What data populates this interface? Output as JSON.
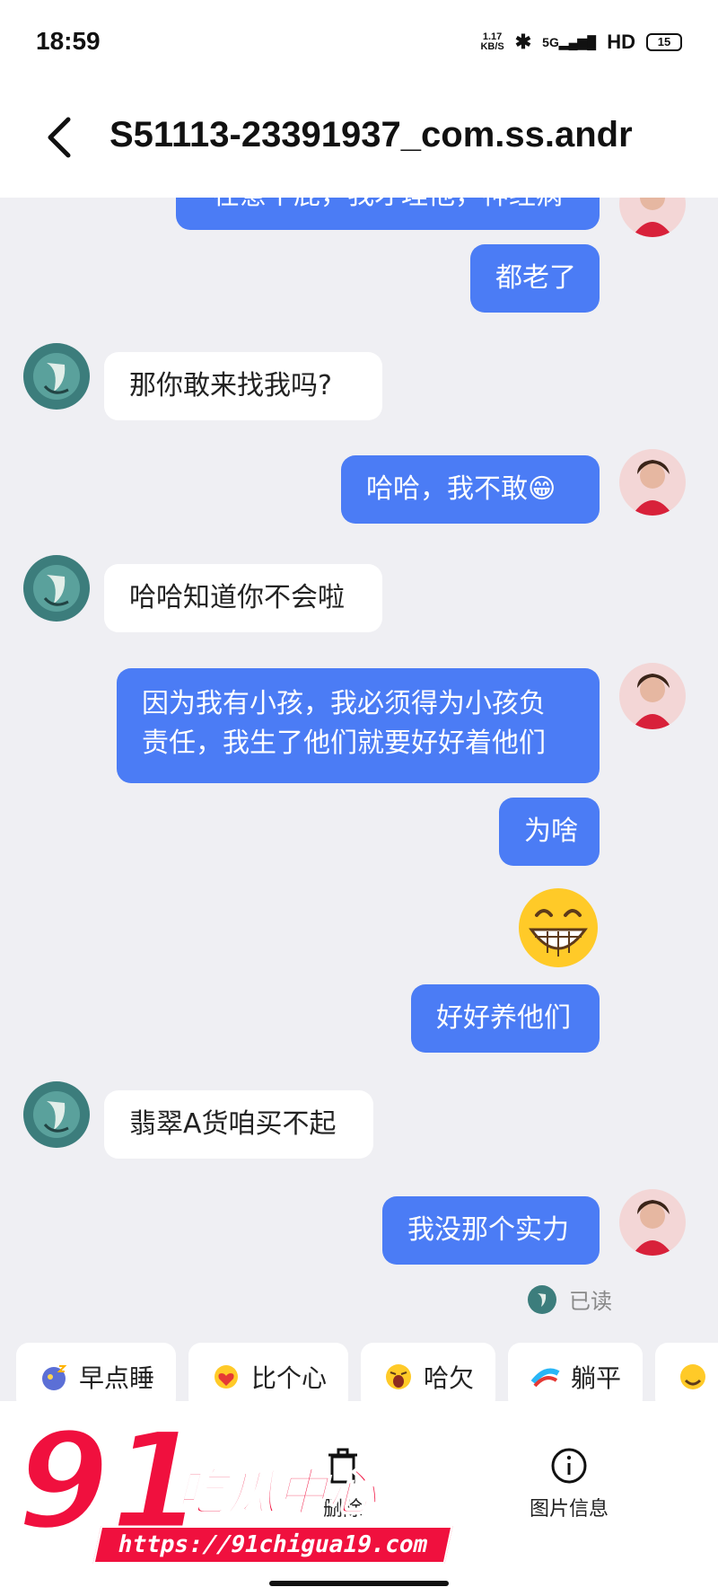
{
  "status_bar": {
    "time": "18:59",
    "net_speed_value": "1.17",
    "net_speed_unit": "KB/S",
    "network": "5G",
    "hd": "HD",
    "battery": "15"
  },
  "header": {
    "title": "S51113-23391937_com.ss.andr"
  },
  "messages": [
    {
      "side": "out",
      "text": "在意个屁，我才理他，神经病"
    },
    {
      "side": "out",
      "text": "都老了"
    },
    {
      "side": "in",
      "text": "那你敢来找我吗?"
    },
    {
      "side": "out",
      "text": "哈哈，我不敢😁"
    },
    {
      "side": "in",
      "text": "哈哈知道你不会啦"
    },
    {
      "side": "out",
      "text": "因为我有小孩，我必须得为小孩负"
    },
    {
      "side": "out",
      "text": "责任，我生了他们就要好好着他们"
    },
    {
      "side": "out",
      "text": "为啥"
    },
    {
      "side": "out",
      "text": "好好养他们"
    },
    {
      "side": "in",
      "text": "翡翠A货咱买不起"
    },
    {
      "side": "out",
      "text": "我没那个实力"
    }
  ],
  "read_status": "已读",
  "quick_replies": [
    {
      "label": "早点睡",
      "icon": "sleep-emoji-icon"
    },
    {
      "label": "比个心",
      "icon": "heart-hand-emoji-icon"
    },
    {
      "label": "哈欠",
      "icon": "yawn-emoji-icon"
    },
    {
      "label": "躺平",
      "icon": "lie-flat-emoji-icon"
    }
  ],
  "bottom_actions": {
    "delete_label": "删除",
    "image_info_label": "图片信息"
  },
  "watermark": {
    "number": "91",
    "brand": "吃瓜中心",
    "url": "https://91chigua19.com"
  },
  "colors": {
    "outgoing_bubble": "#4b7cf5",
    "incoming_bubble": "#ffffff",
    "chat_background": "#efeff3",
    "watermark_red": "#f0103e"
  }
}
